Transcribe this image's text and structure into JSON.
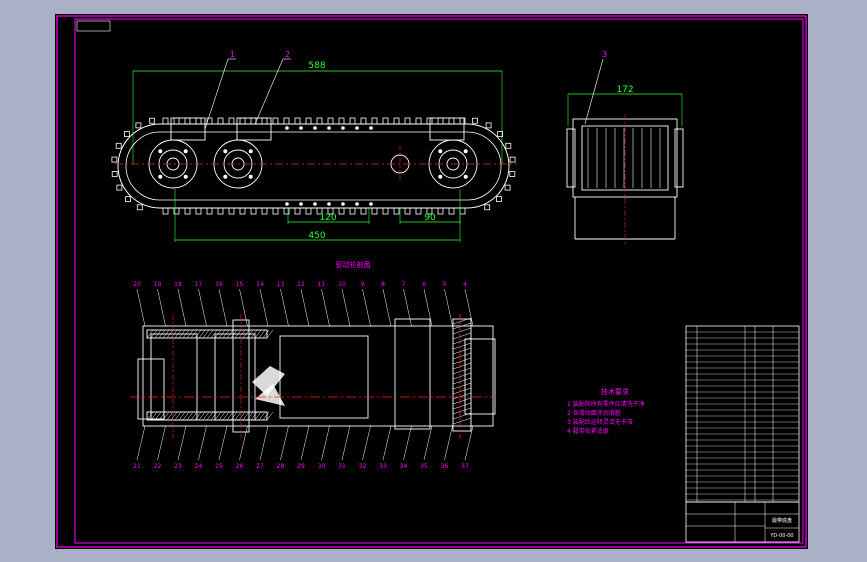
{
  "colors": {
    "page_bg": "#aab0c6",
    "sheet_bg": "#000000",
    "frame": "#ff00ff",
    "outline": "#ffffff",
    "dimension": "#33ff33",
    "centerline": "#ff2020",
    "leader_label": "#ff00ff"
  },
  "top_view": {
    "callouts": [
      "1",
      "2"
    ],
    "dims": {
      "overall_length": "588",
      "pitch_a": "120",
      "pitch_b": "90",
      "wheel_base": "450"
    }
  },
  "side_view": {
    "callouts": [
      "3"
    ],
    "dims": {
      "width": "172"
    }
  },
  "section_view": {
    "title": "驱动轮剖面",
    "top_callouts": [
      "20",
      "19",
      "18",
      "17",
      "16",
      "15",
      "14",
      "13",
      "12",
      "11",
      "10",
      "9",
      "8",
      "7",
      "6",
      "5",
      "4"
    ],
    "bottom_callouts": [
      "21",
      "22",
      "23",
      "24",
      "25",
      "26",
      "27",
      "28",
      "29",
      "30",
      "31",
      "32",
      "33",
      "34",
      "35",
      "36",
      "37"
    ]
  },
  "notes": {
    "title": "技术要求",
    "lines": [
      "1 装配前所有零件应清洗干净",
      "2 各滑动面涂润滑脂",
      "3 装配后运转灵活无卡滞",
      "4 履带张紧适度"
    ]
  },
  "title_block": {
    "drawing_name": "履带底盘",
    "drawing_code": "YD-00-00"
  }
}
